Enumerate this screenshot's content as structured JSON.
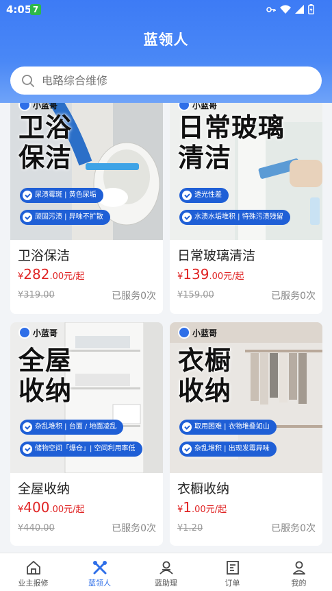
{
  "status_bar": {
    "time": "4:05",
    "app_badge": "7"
  },
  "title": "蓝领人",
  "search": {
    "placeholder": "电路综合维修"
  },
  "colors": {
    "primary": "#3d7bf5",
    "price": "#e02424",
    "tag_blue": "#1f5fd6"
  },
  "services": [
    {
      "brand": "小蓝哥",
      "banner_title": [
        "卫浴",
        "保洁"
      ],
      "tags": [
        "尿渍霉斑 | 黄色尿垢",
        "顽固污渍 | 异味不扩散"
      ],
      "name": "卫浴保洁",
      "price_symbol": "¥",
      "price_int": "282",
      "price_suffix": ".00元/起",
      "original_price": "¥319.00",
      "served": "已服务0次"
    },
    {
      "brand": "小蓝哥",
      "banner_title": [
        "日常玻璃",
        "清洁"
      ],
      "tags": [
        "透光性差",
        "水渍水垢堆积 | 特殊污渍残留"
      ],
      "name": "日常玻璃清洁",
      "price_symbol": "¥",
      "price_int": "139",
      "price_suffix": ".00元/起",
      "original_price": "¥159.00",
      "served": "已服务0次"
    },
    {
      "brand": "小蓝哥",
      "banner_title": [
        "全屋",
        "收纳"
      ],
      "tags": [
        "杂乱堆积 | 台面 / 地面凌乱",
        "储物空间「爆仓」| 空间利用率低"
      ],
      "name": "全屋收纳",
      "price_symbol": "¥",
      "price_int": "400",
      "price_suffix": ".00元/起",
      "original_price": "¥440.00",
      "served": "已服务0次"
    },
    {
      "brand": "小蓝哥",
      "banner_title": [
        "衣橱",
        "收纳"
      ],
      "tags": [
        "取用困难 | 衣物堆叠如山",
        "杂乱堆积 | 出现发霉异味"
      ],
      "name": "衣橱收纳",
      "price_symbol": "¥",
      "price_int": "1",
      "price_suffix": ".00元/起",
      "original_price": "¥1.20",
      "served": "已服务0次"
    }
  ],
  "tabbar": [
    {
      "label": "业主报修",
      "icon": "home-icon",
      "active": false
    },
    {
      "label": "蓝领人",
      "icon": "tools-icon",
      "active": true
    },
    {
      "label": "蓝助理",
      "icon": "person-icon",
      "active": false
    },
    {
      "label": "订单",
      "icon": "order-icon",
      "active": false
    },
    {
      "label": "我的",
      "icon": "profile-icon",
      "active": false
    }
  ]
}
